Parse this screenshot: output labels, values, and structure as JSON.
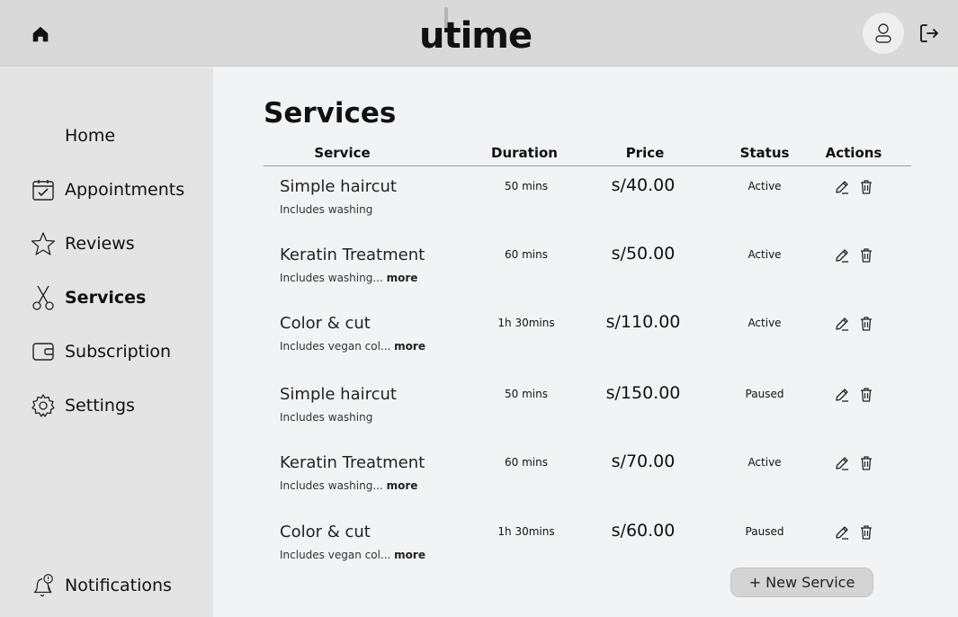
{
  "header": {
    "logo_text": "utime",
    "icons": {
      "home": "home-icon",
      "avatar": "user-icon",
      "logout": "logout-icon"
    }
  },
  "sidebar": {
    "items": [
      {
        "label": "Home",
        "icon": "",
        "active": false
      },
      {
        "label": "Appointments",
        "icon": "calendar-check-icon",
        "active": false
      },
      {
        "label": "Reviews",
        "icon": "star-icon",
        "active": false
      },
      {
        "label": "Services",
        "icon": "scissors-icon",
        "active": true
      },
      {
        "label": "Subscription",
        "icon": "wallet-icon",
        "active": false
      },
      {
        "label": "Settings",
        "icon": "gear-icon",
        "active": false
      }
    ],
    "notifications_label": "Notifications"
  },
  "main": {
    "title": "Services",
    "columns": [
      "Service",
      "Duration",
      "Price",
      "Status",
      "Actions"
    ],
    "rows": [
      {
        "name": "Simple haircut",
        "desc": "Includes washing",
        "more": "",
        "duration": "50 mins",
        "price": "s/40.00",
        "status": "Active"
      },
      {
        "name": "Keratin Treatment",
        "desc": "Includes washing...",
        "more": "more",
        "duration": "60 mins",
        "price": "s/50.00",
        "status": "Active"
      },
      {
        "name": "Color & cut",
        "desc": "Includes vegan col...",
        "more": "more",
        "duration": "1h 30mins",
        "price": "s/110.00",
        "status": "Active"
      },
      {
        "name": "Simple haircut",
        "desc": "Includes washing",
        "more": "",
        "duration": "50 mins",
        "price": "s/150.00",
        "status": "Paused"
      },
      {
        "name": "Keratin Treatment",
        "desc": "Includes washing...",
        "more": "more",
        "duration": "60 mins",
        "price": "s/70.00",
        "status": "Active"
      },
      {
        "name": "Color & cut",
        "desc": "Includes vegan col...",
        "more": "more",
        "duration": "1h 30mins",
        "price": "s/60.00",
        "status": "Paused"
      }
    ],
    "new_service_label": "+ New Service"
  }
}
